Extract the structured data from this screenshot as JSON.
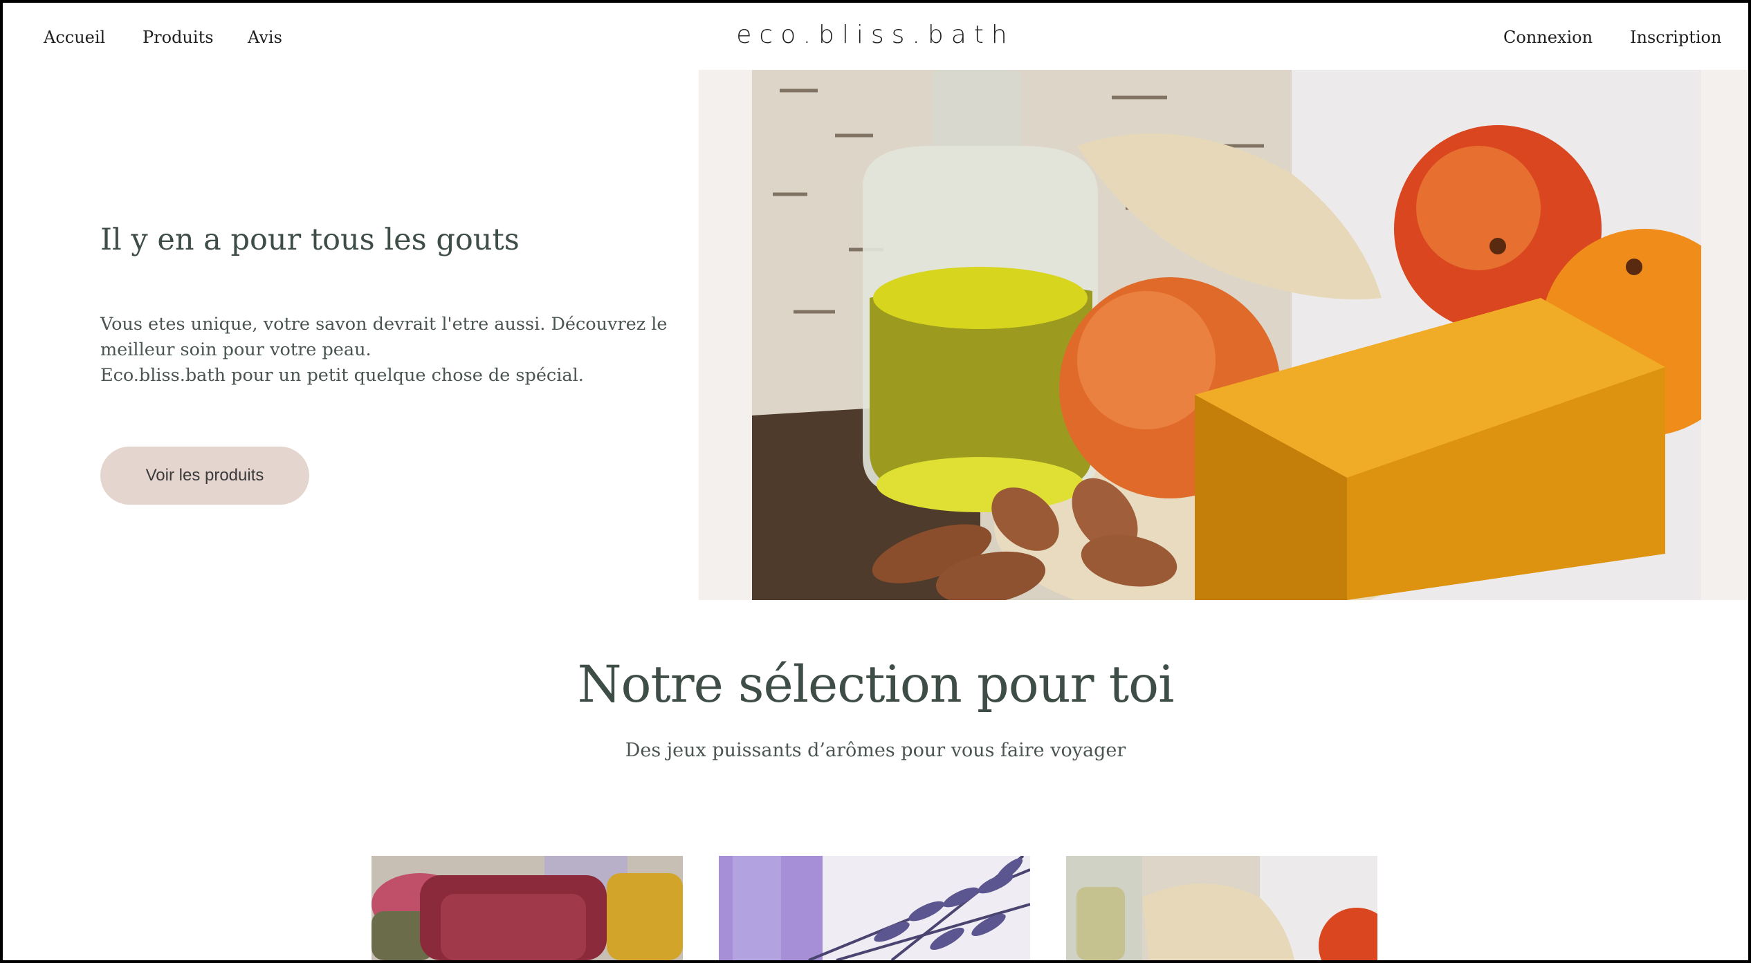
{
  "nav": {
    "left": [
      "Accueil",
      "Produits",
      "Avis"
    ],
    "brand": "eco.bliss.bath",
    "right": [
      "Connexion",
      "Inscription"
    ]
  },
  "hero": {
    "title": "Il y en a pour tous les gouts",
    "text_lines": [
      "Vous etes unique, votre savon devrait l'etre aussi. Découvrez le",
      "meilleur soin pour votre peau.",
      "Eco.bliss.bath pour un petit quelque chose de spécial."
    ],
    "cta": "Voir les produits"
  },
  "selection": {
    "title": "Notre sélection pour toi",
    "subtitle": "Des jeux puissants d’arômes pour vous faire voyager"
  },
  "colors": {
    "heading": "#3f4d47",
    "cta_bg": "#e5d5cf",
    "hero_bg": "#f4f0ee"
  }
}
